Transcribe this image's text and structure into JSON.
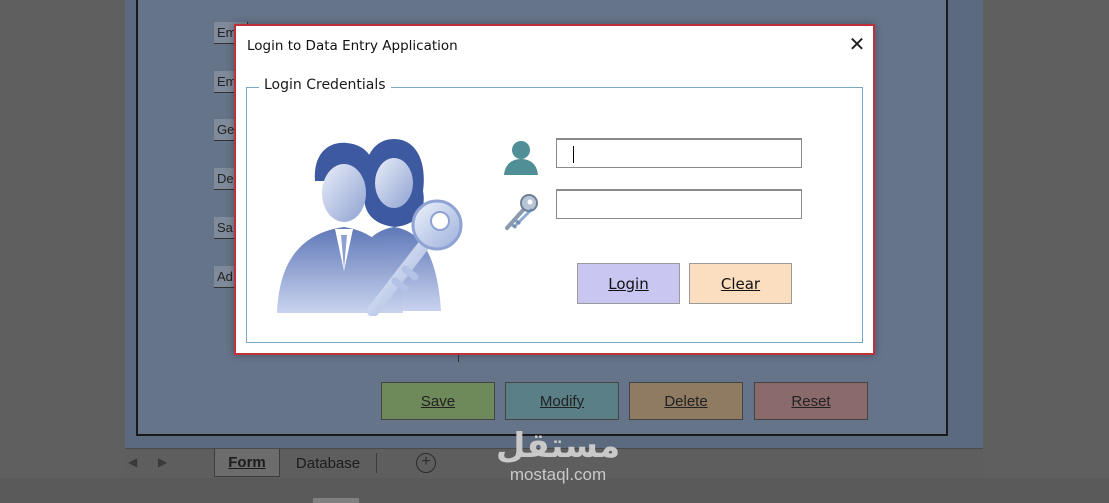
{
  "background": {
    "form_labels": [
      "Em",
      "Em",
      "Ge",
      "De",
      "Sa",
      "Ad"
    ],
    "buttons": {
      "save": "Save",
      "modify": "Modify",
      "delete": "Delete",
      "reset": "Reset"
    },
    "sheet_tabs": {
      "active": "Form",
      "other": "Database",
      "add": "+"
    }
  },
  "dialog": {
    "title": "Login to Data Entry Application",
    "close": "✕",
    "group_title": "Login Credentials",
    "username": {
      "value": "",
      "placeholder": ""
    },
    "password": {
      "value": "",
      "placeholder": ""
    },
    "login_label": "Login",
    "clear_label": "Clear"
  },
  "watermark": {
    "arabic": "مستقل",
    "latin": "mostaql.com"
  },
  "colors": {
    "dialog_border": "#c0303a",
    "group_border": "#7aa7c7",
    "login_bg": "#c9c6f2",
    "clear_bg": "#fbddc0"
  },
  "icons": [
    "user-icon",
    "key-icon",
    "people-with-key-illustration",
    "close-icon",
    "add-sheet-icon"
  ]
}
